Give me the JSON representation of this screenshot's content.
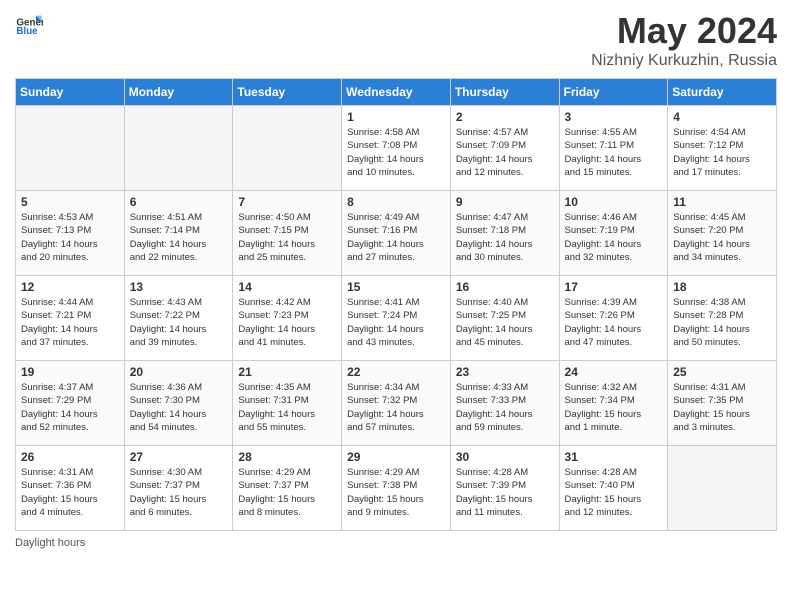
{
  "header": {
    "logo_general": "General",
    "logo_blue": "Blue",
    "title": "May 2024",
    "location": "Nizhniy Kurkuzhin, Russia"
  },
  "days_of_week": [
    "Sunday",
    "Monday",
    "Tuesday",
    "Wednesday",
    "Thursday",
    "Friday",
    "Saturday"
  ],
  "weeks": [
    {
      "days": [
        {
          "num": "",
          "info": ""
        },
        {
          "num": "",
          "info": ""
        },
        {
          "num": "",
          "info": ""
        },
        {
          "num": "1",
          "info": "Sunrise: 4:58 AM\nSunset: 7:08 PM\nDaylight: 14 hours\nand 10 minutes."
        },
        {
          "num": "2",
          "info": "Sunrise: 4:57 AM\nSunset: 7:09 PM\nDaylight: 14 hours\nand 12 minutes."
        },
        {
          "num": "3",
          "info": "Sunrise: 4:55 AM\nSunset: 7:11 PM\nDaylight: 14 hours\nand 15 minutes."
        },
        {
          "num": "4",
          "info": "Sunrise: 4:54 AM\nSunset: 7:12 PM\nDaylight: 14 hours\nand 17 minutes."
        }
      ]
    },
    {
      "days": [
        {
          "num": "5",
          "info": "Sunrise: 4:53 AM\nSunset: 7:13 PM\nDaylight: 14 hours\nand 20 minutes."
        },
        {
          "num": "6",
          "info": "Sunrise: 4:51 AM\nSunset: 7:14 PM\nDaylight: 14 hours\nand 22 minutes."
        },
        {
          "num": "7",
          "info": "Sunrise: 4:50 AM\nSunset: 7:15 PM\nDaylight: 14 hours\nand 25 minutes."
        },
        {
          "num": "8",
          "info": "Sunrise: 4:49 AM\nSunset: 7:16 PM\nDaylight: 14 hours\nand 27 minutes."
        },
        {
          "num": "9",
          "info": "Sunrise: 4:47 AM\nSunset: 7:18 PM\nDaylight: 14 hours\nand 30 minutes."
        },
        {
          "num": "10",
          "info": "Sunrise: 4:46 AM\nSunset: 7:19 PM\nDaylight: 14 hours\nand 32 minutes."
        },
        {
          "num": "11",
          "info": "Sunrise: 4:45 AM\nSunset: 7:20 PM\nDaylight: 14 hours\nand 34 minutes."
        }
      ]
    },
    {
      "days": [
        {
          "num": "12",
          "info": "Sunrise: 4:44 AM\nSunset: 7:21 PM\nDaylight: 14 hours\nand 37 minutes."
        },
        {
          "num": "13",
          "info": "Sunrise: 4:43 AM\nSunset: 7:22 PM\nDaylight: 14 hours\nand 39 minutes."
        },
        {
          "num": "14",
          "info": "Sunrise: 4:42 AM\nSunset: 7:23 PM\nDaylight: 14 hours\nand 41 minutes."
        },
        {
          "num": "15",
          "info": "Sunrise: 4:41 AM\nSunset: 7:24 PM\nDaylight: 14 hours\nand 43 minutes."
        },
        {
          "num": "16",
          "info": "Sunrise: 4:40 AM\nSunset: 7:25 PM\nDaylight: 14 hours\nand 45 minutes."
        },
        {
          "num": "17",
          "info": "Sunrise: 4:39 AM\nSunset: 7:26 PM\nDaylight: 14 hours\nand 47 minutes."
        },
        {
          "num": "18",
          "info": "Sunrise: 4:38 AM\nSunset: 7:28 PM\nDaylight: 14 hours\nand 50 minutes."
        }
      ]
    },
    {
      "days": [
        {
          "num": "19",
          "info": "Sunrise: 4:37 AM\nSunset: 7:29 PM\nDaylight: 14 hours\nand 52 minutes."
        },
        {
          "num": "20",
          "info": "Sunrise: 4:36 AM\nSunset: 7:30 PM\nDaylight: 14 hours\nand 54 minutes."
        },
        {
          "num": "21",
          "info": "Sunrise: 4:35 AM\nSunset: 7:31 PM\nDaylight: 14 hours\nand 55 minutes."
        },
        {
          "num": "22",
          "info": "Sunrise: 4:34 AM\nSunset: 7:32 PM\nDaylight: 14 hours\nand 57 minutes."
        },
        {
          "num": "23",
          "info": "Sunrise: 4:33 AM\nSunset: 7:33 PM\nDaylight: 14 hours\nand 59 minutes."
        },
        {
          "num": "24",
          "info": "Sunrise: 4:32 AM\nSunset: 7:34 PM\nDaylight: 15 hours\nand 1 minute."
        },
        {
          "num": "25",
          "info": "Sunrise: 4:31 AM\nSunset: 7:35 PM\nDaylight: 15 hours\nand 3 minutes."
        }
      ]
    },
    {
      "days": [
        {
          "num": "26",
          "info": "Sunrise: 4:31 AM\nSunset: 7:36 PM\nDaylight: 15 hours\nand 4 minutes."
        },
        {
          "num": "27",
          "info": "Sunrise: 4:30 AM\nSunset: 7:37 PM\nDaylight: 15 hours\nand 6 minutes."
        },
        {
          "num": "28",
          "info": "Sunrise: 4:29 AM\nSunset: 7:37 PM\nDaylight: 15 hours\nand 8 minutes."
        },
        {
          "num": "29",
          "info": "Sunrise: 4:29 AM\nSunset: 7:38 PM\nDaylight: 15 hours\nand 9 minutes."
        },
        {
          "num": "30",
          "info": "Sunrise: 4:28 AM\nSunset: 7:39 PM\nDaylight: 15 hours\nand 11 minutes."
        },
        {
          "num": "31",
          "info": "Sunrise: 4:28 AM\nSunset: 7:40 PM\nDaylight: 15 hours\nand 12 minutes."
        },
        {
          "num": "",
          "info": ""
        }
      ]
    }
  ],
  "footer": {
    "daylight_label": "Daylight hours"
  }
}
